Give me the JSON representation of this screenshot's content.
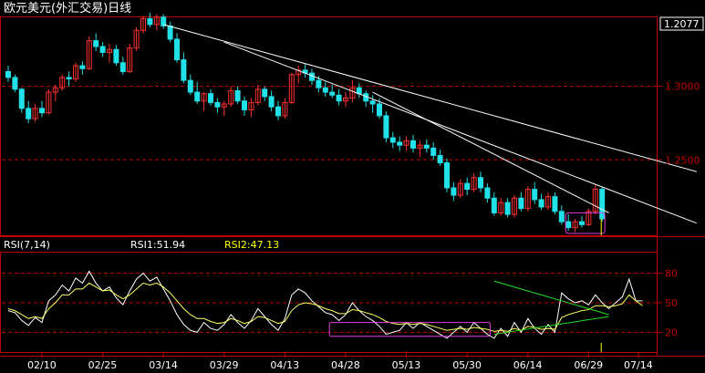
{
  "window": {
    "title": "欧元美元(外汇交易)日线"
  },
  "colors": {
    "background": "#000000",
    "frame": "#c00000",
    "up_candle": "#ff3030",
    "down_candle": "#20e0e8",
    "rsi1_line": "#ffffff",
    "rsi2_line": "#ffff60",
    "trendline": "#ffffff",
    "green_line": "#20e020",
    "highlight_box": "#e040e0",
    "text_white": "#ffffff",
    "text_yellow": "#ffff00"
  },
  "chart_data": [
    {
      "type": "candlestick",
      "title": "欧元美元(外汇交易)日线",
      "current_price_label": "1.2077",
      "y_ticks": [
        "1.3000",
        "1.2500"
      ],
      "ylim": [
        1.2,
        1.345
      ],
      "ohlc": [
        [
          1.31,
          1.314,
          1.303,
          1.306
        ],
        [
          1.306,
          1.308,
          1.296,
          1.298
        ],
        [
          1.298,
          1.299,
          1.282,
          1.285
        ],
        [
          1.285,
          1.29,
          1.275,
          1.278
        ],
        [
          1.278,
          1.288,
          1.276,
          1.285
        ],
        [
          1.285,
          1.29,
          1.279,
          1.282
        ],
        [
          1.282,
          1.298,
          1.281,
          1.296
        ],
        [
          1.296,
          1.301,
          1.29,
          1.299
        ],
        [
          1.299,
          1.308,
          1.297,
          1.306
        ],
        [
          1.306,
          1.31,
          1.3,
          1.305
        ],
        [
          1.305,
          1.316,
          1.303,
          1.314
        ],
        [
          1.314,
          1.317,
          1.308,
          1.312
        ],
        [
          1.312,
          1.334,
          1.311,
          1.331
        ],
        [
          1.331,
          1.336,
          1.324,
          1.327
        ],
        [
          1.327,
          1.33,
          1.32,
          1.323
        ],
        [
          1.323,
          1.329,
          1.316,
          1.325
        ],
        [
          1.325,
          1.328,
          1.314,
          1.316
        ],
        [
          1.316,
          1.32,
          1.308,
          1.31
        ],
        [
          1.31,
          1.329,
          1.309,
          1.326
        ],
        [
          1.326,
          1.34,
          1.324,
          1.338
        ],
        [
          1.338,
          1.348,
          1.336,
          1.346
        ],
        [
          1.346,
          1.35,
          1.34,
          1.342
        ],
        [
          1.342,
          1.349,
          1.338,
          1.347
        ],
        [
          1.347,
          1.349,
          1.339,
          1.341
        ],
        [
          1.341,
          1.344,
          1.33,
          1.332
        ],
        [
          1.332,
          1.336,
          1.316,
          1.318
        ],
        [
          1.318,
          1.323,
          1.302,
          1.304
        ],
        [
          1.304,
          1.308,
          1.294,
          1.296
        ],
        [
          1.296,
          1.303,
          1.288,
          1.29
        ],
        [
          1.29,
          1.296,
          1.283,
          1.295
        ],
        [
          1.295,
          1.298,
          1.287,
          1.289
        ],
        [
          1.289,
          1.292,
          1.282,
          1.286
        ],
        [
          1.286,
          1.29,
          1.28,
          1.288
        ],
        [
          1.288,
          1.3,
          1.286,
          1.297
        ],
        [
          1.297,
          1.3,
          1.288,
          1.29
        ],
        [
          1.29,
          1.293,
          1.28,
          1.284
        ],
        [
          1.284,
          1.292,
          1.279,
          1.289
        ],
        [
          1.289,
          1.301,
          1.287,
          1.298
        ],
        [
          1.298,
          1.3,
          1.29,
          1.293
        ],
        [
          1.293,
          1.297,
          1.283,
          1.286
        ],
        [
          1.286,
          1.29,
          1.277,
          1.28
        ],
        [
          1.28,
          1.292,
          1.278,
          1.289
        ],
        [
          1.289,
          1.309,
          1.288,
          1.308
        ],
        [
          1.308,
          1.314,
          1.302,
          1.311
        ],
        [
          1.311,
          1.315,
          1.306,
          1.309
        ],
        [
          1.309,
          1.312,
          1.301,
          1.304
        ],
        [
          1.304,
          1.307,
          1.296,
          1.299
        ],
        [
          1.299,
          1.303,
          1.293,
          1.296
        ],
        [
          1.296,
          1.301,
          1.292,
          1.294
        ],
        [
          1.294,
          1.298,
          1.287,
          1.29
        ],
        [
          1.29,
          1.296,
          1.286,
          1.292
        ],
        [
          1.292,
          1.304,
          1.289,
          1.299
        ],
        [
          1.299,
          1.302,
          1.292,
          1.295
        ],
        [
          1.295,
          1.297,
          1.286,
          1.29
        ],
        [
          1.29,
          1.294,
          1.282,
          1.288
        ],
        [
          1.288,
          1.292,
          1.278,
          1.28
        ],
        [
          1.28,
          1.283,
          1.262,
          1.265
        ],
        [
          1.265,
          1.269,
          1.258,
          1.262
        ],
        [
          1.262,
          1.266,
          1.256,
          1.26
        ],
        [
          1.26,
          1.266,
          1.256,
          1.263
        ],
        [
          1.263,
          1.267,
          1.255,
          1.258
        ],
        [
          1.258,
          1.263,
          1.252,
          1.26
        ],
        [
          1.26,
          1.264,
          1.255,
          1.258
        ],
        [
          1.258,
          1.262,
          1.25,
          1.253
        ],
        [
          1.253,
          1.257,
          1.246,
          1.248
        ],
        [
          1.248,
          1.251,
          1.228,
          1.231
        ],
        [
          1.231,
          1.235,
          1.222,
          1.226
        ],
        [
          1.226,
          1.237,
          1.224,
          1.234
        ],
        [
          1.234,
          1.238,
          1.226,
          1.23
        ],
        [
          1.23,
          1.241,
          1.228,
          1.238
        ],
        [
          1.238,
          1.242,
          1.228,
          1.231
        ],
        [
          1.231,
          1.234,
          1.221,
          1.224
        ],
        [
          1.224,
          1.228,
          1.212,
          1.214
        ],
        [
          1.214,
          1.224,
          1.212,
          1.221
        ],
        [
          1.221,
          1.224,
          1.211,
          1.213
        ],
        [
          1.213,
          1.226,
          1.211,
          1.224
        ],
        [
          1.224,
          1.228,
          1.215,
          1.217
        ],
        [
          1.217,
          1.232,
          1.215,
          1.23
        ],
        [
          1.23,
          1.235,
          1.22,
          1.223
        ],
        [
          1.223,
          1.227,
          1.216,
          1.218
        ],
        [
          1.218,
          1.228,
          1.216,
          1.225
        ],
        [
          1.225,
          1.228,
          1.213,
          1.215
        ],
        [
          1.215,
          1.219,
          1.206,
          1.208
        ],
        [
          1.208,
          1.213,
          1.202,
          1.204
        ],
        [
          1.204,
          1.21,
          1.201,
          1.208
        ],
        [
          1.208,
          1.212,
          1.204,
          1.206
        ],
        [
          1.206,
          1.217,
          1.205,
          1.215
        ],
        [
          1.215,
          1.233,
          1.213,
          1.23
        ],
        [
          1.23,
          1.232,
          1.208,
          1.21
        ]
      ],
      "trendlines": [
        {
          "from": [
            23,
            1.342
          ],
          "to": [
            102,
            1.242
          ]
        },
        {
          "from": [
            32,
            1.33
          ],
          "to": [
            102,
            1.207
          ]
        },
        {
          "from": [
            54,
            1.296
          ],
          "to": [
            89,
            1.214
          ]
        }
      ],
      "highlight_box": {
        "x_range": [
          83,
          88
        ],
        "y_range": [
          1.2,
          1.214
        ]
      }
    },
    {
      "type": "line",
      "title": "RSI(7,14)",
      "labels": [
        "RSI(7,14)",
        "RSI1:51.94",
        "RSI2:47.13"
      ],
      "y_ticks": [
        "80",
        "50",
        "20"
      ],
      "ylim": [
        0,
        100
      ],
      "x_tick_labels": [
        "02/10",
        "02/25",
        "03/14",
        "03/29",
        "04/13",
        "04/28",
        "05/13",
        "05/30",
        "06/14",
        "06/29",
        "07/14"
      ],
      "series": [
        {
          "name": "RSI1",
          "values": [
            42,
            40,
            32,
            27,
            35,
            30,
            52,
            58,
            68,
            62,
            75,
            70,
            82,
            70,
            62,
            66,
            55,
            48,
            62,
            74,
            80,
            72,
            76,
            64,
            52,
            38,
            28,
            22,
            20,
            30,
            24,
            22,
            28,
            38,
            30,
            24,
            32,
            44,
            36,
            28,
            22,
            34,
            58,
            64,
            60,
            52,
            46,
            40,
            38,
            32,
            38,
            50,
            42,
            36,
            32,
            26,
            18,
            20,
            22,
            30,
            24,
            30,
            26,
            22,
            18,
            14,
            20,
            26,
            20,
            30,
            24,
            18,
            14,
            24,
            16,
            30,
            20,
            34,
            24,
            18,
            28,
            20,
            60,
            54,
            50,
            52,
            48,
            58,
            50,
            44,
            50,
            56,
            74,
            52,
            52
          ]
        },
        {
          "name": "RSI2",
          "values": [
            44,
            42,
            38,
            34,
            36,
            34,
            44,
            50,
            58,
            58,
            64,
            64,
            70,
            66,
            62,
            63,
            58,
            54,
            58,
            64,
            70,
            68,
            70,
            66,
            60,
            52,
            44,
            38,
            34,
            34,
            31,
            29,
            30,
            34,
            32,
            29,
            31,
            36,
            35,
            32,
            29,
            31,
            42,
            48,
            50,
            49,
            47,
            44,
            42,
            39,
            39,
            43,
            42,
            40,
            38,
            35,
            31,
            29,
            28,
            29,
            28,
            29,
            28,
            26,
            24,
            22,
            23,
            24,
            23,
            25,
            24,
            23,
            21,
            22,
            21,
            24,
            22,
            26,
            25,
            23,
            24,
            23,
            35,
            38,
            40,
            42,
            43,
            47,
            47,
            46,
            47,
            49,
            58,
            52,
            47
          ]
        }
      ],
      "trendlines": [
        {
          "from": [
            72,
            72
          ],
          "to": [
            89,
            38
          ]
        },
        {
          "from": [
            72,
            18
          ],
          "to": [
            89,
            36
          ]
        }
      ],
      "highlight_box": {
        "x_range": [
          48,
          71
        ],
        "y_range": [
          16,
          30
        ]
      }
    }
  ]
}
